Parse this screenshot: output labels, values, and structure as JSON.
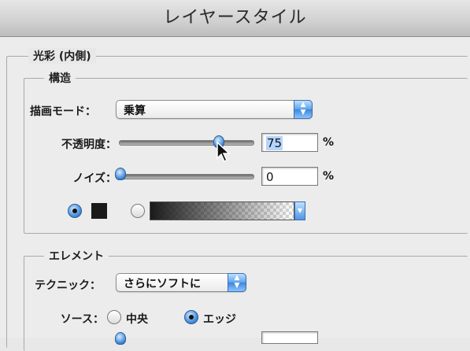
{
  "window": {
    "title": "レイヤースタイル"
  },
  "inner_glow": {
    "group_label": "光彩 (内側)",
    "structure": {
      "group_label": "構造",
      "blend_mode": {
        "label": "描画モード：",
        "value": "乗算"
      },
      "opacity": {
        "label": "不透明度：",
        "value": "75",
        "unit": "%",
        "slider_fraction": 0.75
      },
      "noise": {
        "label": "ノイズ：",
        "value": "0",
        "unit": "%",
        "slider_fraction": 0.0
      },
      "fill": {
        "color_selected": true,
        "color": "#1a1a1a",
        "gradient_selected": false
      }
    },
    "elements": {
      "group_label": "エレメント",
      "technique": {
        "label": "テクニック：",
        "value": "さらにソフトに"
      },
      "source": {
        "label": "ソース：",
        "options": [
          "中央",
          "エッジ"
        ],
        "selected": "エッジ"
      }
    }
  },
  "icons": {
    "select_arrow": "up-down-chevron-icon",
    "gradient_menu": "chevron-down-icon",
    "cursor": "mouse-pointer-icon"
  },
  "colors": {
    "accent": "#3e86d8",
    "panel": "#ececec"
  }
}
